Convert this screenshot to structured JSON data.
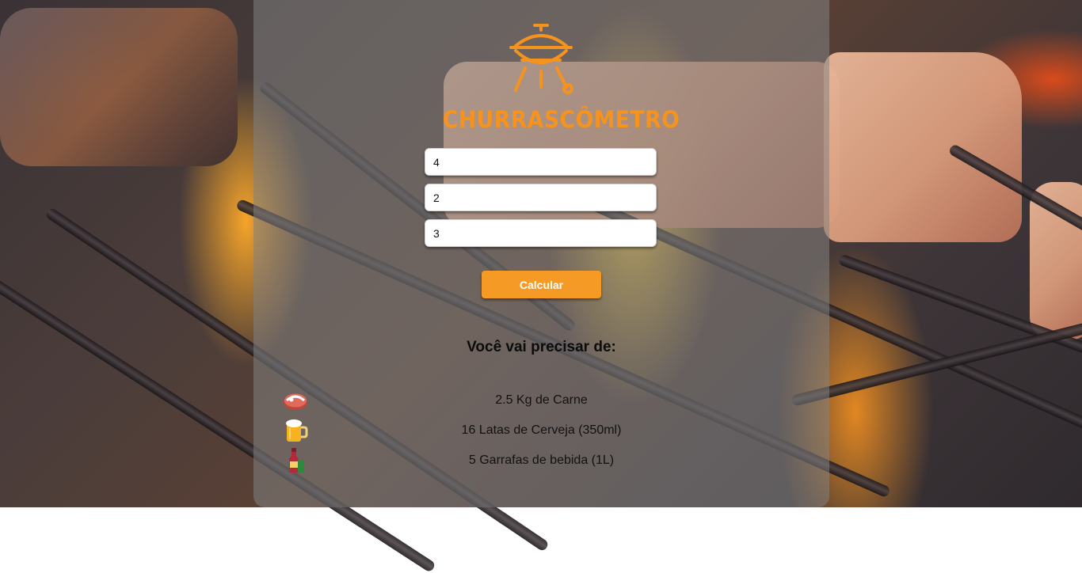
{
  "app": {
    "logo_text": "CHURRASCÔMETRO",
    "accent_color": "#f5931e"
  },
  "form": {
    "field_1_value": "4",
    "field_2_value": "2",
    "field_3_value": "3",
    "submit_label": "Calcular"
  },
  "results": {
    "title": "Você vai precisar de:",
    "items": [
      {
        "icon": "meat-icon",
        "text": "2.5 Kg de Carne"
      },
      {
        "icon": "beer-icon",
        "text": "16 Latas de Cerveja (350ml)"
      },
      {
        "icon": "bottle-icon",
        "text": "5 Garrafas de bebida (1L)"
      }
    ]
  }
}
